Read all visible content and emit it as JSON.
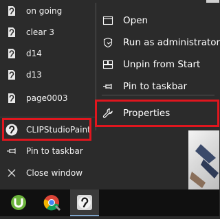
{
  "jump_list": {
    "recent_items": [
      {
        "label": "on going",
        "icon": "clip-studio-file-icon"
      },
      {
        "label": "clear 3",
        "icon": "clip-studio-file-icon"
      },
      {
        "label": "d14",
        "icon": "clip-studio-file-icon"
      },
      {
        "label": "d13",
        "icon": "clip-studio-file-icon"
      },
      {
        "label": "page0003",
        "icon": "clip-studio-file-icon"
      }
    ],
    "app_item": {
      "label": "CLIPStudioPaint",
      "icon": "clip-studio-paint-icon"
    },
    "pin_to_taskbar": {
      "label": "Pin to taskbar",
      "icon": "pin-icon"
    },
    "close_window": {
      "label": "Close window",
      "icon": "close-icon"
    }
  },
  "context_menu": {
    "items": [
      {
        "label": "Open",
        "icon": "window-icon"
      },
      {
        "label": "Run as administrator",
        "icon": "shield-icon"
      },
      {
        "label": "Unpin from Start",
        "icon": "unpin-icon"
      },
      {
        "label": "Pin to taskbar",
        "icon": "pin-icon"
      },
      {
        "label": "Properties",
        "icon": "wrench-icon"
      }
    ]
  },
  "taskbar": {
    "apps": [
      {
        "name": "utorrent",
        "icon": "utorrent-icon"
      },
      {
        "name": "chrome",
        "icon": "chrome-icon"
      },
      {
        "name": "clip-studio-paint",
        "icon": "clip-studio-paint-icon",
        "active": true
      }
    ]
  },
  "colors": {
    "menu_bg": "#2b2b2b",
    "taskbar_bg": "#101010",
    "highlight_red": "#e0161e",
    "text": "#ffffff"
  }
}
